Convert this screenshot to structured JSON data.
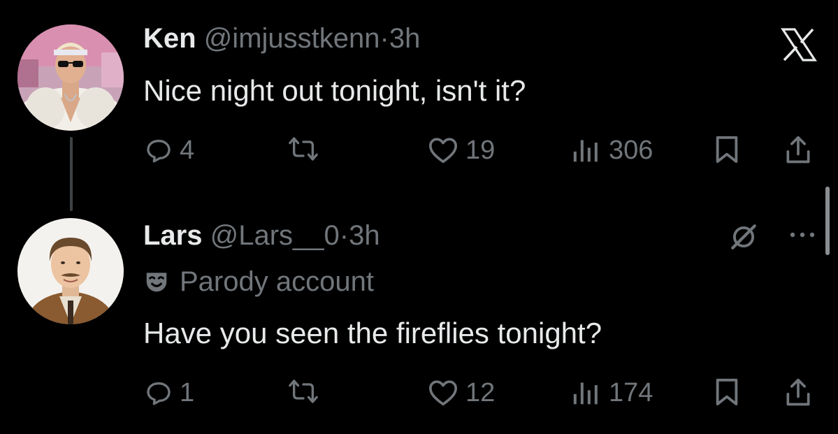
{
  "colors": {
    "background": "#000000",
    "primary_text": "#e7e9ea",
    "secondary_text": "#71767b",
    "thread_line": "#3e4144"
  },
  "app_icon": "x-logo-icon",
  "tweets": [
    {
      "name": "Ken",
      "handle": "@imjusstkenn",
      "separator": "·",
      "time": "3h",
      "text": "Nice night out tonight, isn't it?",
      "stats": {
        "replies": "4",
        "reposts": "",
        "likes": "19",
        "views": "306"
      }
    },
    {
      "name": "Lars",
      "handle": "@Lars__0",
      "separator": "·",
      "time": "3h",
      "label": "Parody account",
      "text": "Have you seen the fireflies tonight?",
      "stats": {
        "replies": "1",
        "reposts": "",
        "likes": "12",
        "views": "174"
      }
    }
  ]
}
